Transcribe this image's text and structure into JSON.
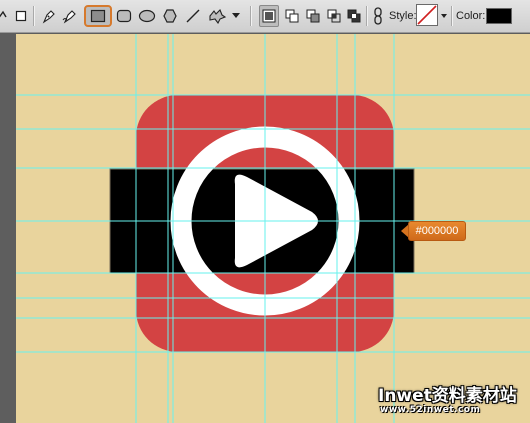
{
  "options_bar": {
    "tools": [
      {
        "name": "lasso-tool-icon"
      },
      {
        "name": "rectangle-select-icon"
      },
      {
        "name": "pen-tool-icon"
      },
      {
        "name": "freeform-pen-icon"
      },
      {
        "name": "rectangle-tool-icon",
        "selected": true
      },
      {
        "name": "rounded-rectangle-tool-icon"
      },
      {
        "name": "ellipse-tool-icon"
      },
      {
        "name": "polygon-tool-icon"
      },
      {
        "name": "line-tool-icon"
      },
      {
        "name": "custom-shape-tool-icon"
      },
      {
        "name": "dropdown-arrow-icon"
      }
    ],
    "path_ops": [
      "new-shape-layer-icon",
      "add-to-shape-icon",
      "subtract-shape-icon",
      "intersect-shape-icon",
      "exclude-shape-icon"
    ],
    "style_label": "Style:",
    "color_label": "Color:",
    "color_value": "#000000"
  },
  "canvas": {
    "tooltip_text": "#000000",
    "colors": {
      "background": "#e9d49d",
      "rounded_square": "#d34343",
      "ring": "#ffffff",
      "black_bar": "#000000",
      "play": "#ffffff",
      "guide": "#66f2ee",
      "accent": "#d6792c"
    }
  },
  "watermark": {
    "title": "Inwet资料素材站",
    "url": "www.52inwet.com"
  }
}
